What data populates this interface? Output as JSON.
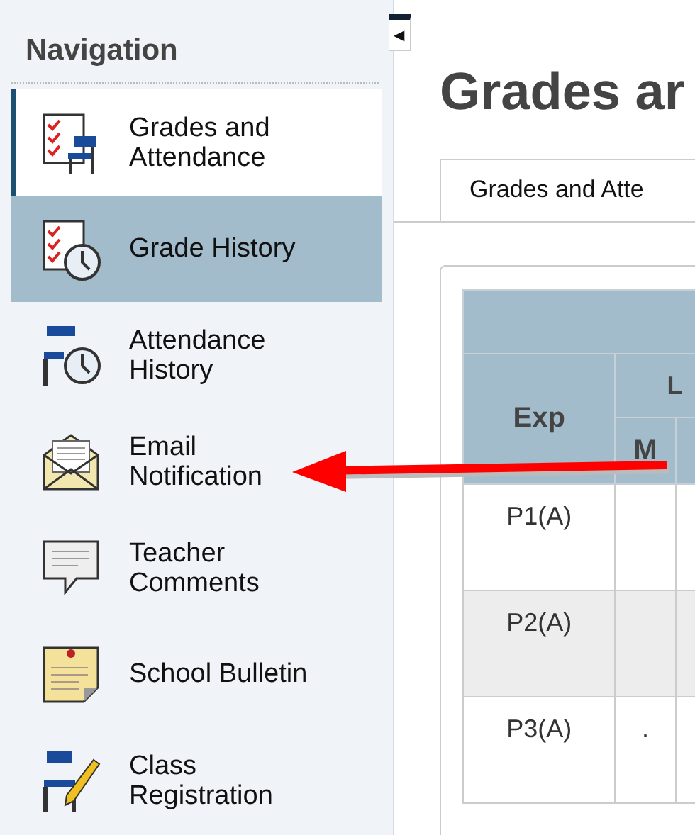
{
  "sidebar": {
    "heading": "Navigation",
    "items": [
      {
        "label": "Grades and Attendance",
        "kind": "grades",
        "selected": true,
        "highlighted": false
      },
      {
        "label": "Grade History",
        "kind": "history",
        "selected": false,
        "highlighted": true
      },
      {
        "label": "Attendance History",
        "kind": "attendance",
        "selected": false,
        "highlighted": false
      },
      {
        "label": "Email Notification",
        "kind": "email",
        "selected": false,
        "highlighted": false
      },
      {
        "label": "Teacher Comments",
        "kind": "comments",
        "selected": false,
        "highlighted": false
      },
      {
        "label": "School Bulletin",
        "kind": "bulletin",
        "selected": false,
        "highlighted": false
      },
      {
        "label": "Class Registration",
        "kind": "registration",
        "selected": false,
        "highlighted": false
      }
    ]
  },
  "collapse_button": {
    "label": "◀"
  },
  "page_title": "Grades ar",
  "tabs": [
    {
      "label": "Grades and Atte",
      "selected": true
    }
  ],
  "table": {
    "group_header": "L",
    "columns": [
      "Exp",
      "M"
    ],
    "rows": [
      {
        "cells": [
          "P1(A)",
          ""
        ],
        "shaded": false
      },
      {
        "cells": [
          "P2(A)",
          ""
        ],
        "shaded": true
      },
      {
        "cells": [
          "P3(A)",
          "."
        ],
        "shaded": false
      }
    ]
  }
}
